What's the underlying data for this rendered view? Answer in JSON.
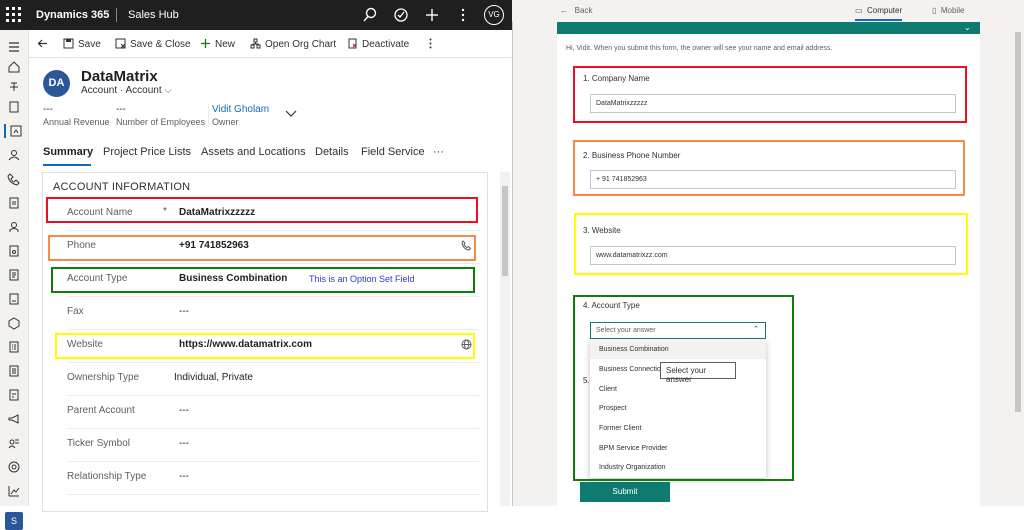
{
  "topbar": {
    "brand": "Dynamics 365",
    "app": "Sales Hub",
    "avatar": "VG"
  },
  "commands": {
    "save": "Save",
    "save_close": "Save & Close",
    "new": "New",
    "org_chart": "Open Org Chart",
    "deactivate": "Deactivate"
  },
  "record": {
    "initials": "DA",
    "name": "DataMatrix",
    "type_line": "Account · Account",
    "kpis": [
      {
        "value": "---",
        "label": "Annual Revenue"
      },
      {
        "value": "---",
        "label": "Number of Employees"
      }
    ],
    "owner": {
      "value": "Vidit Gholam",
      "label": "Owner"
    }
  },
  "tabs": [
    "Summary",
    "Project Price Lists",
    "Assets and Locations",
    "Details",
    "Field Service",
    "···"
  ],
  "section_title": "ACCOUNT INFORMATION",
  "fields": [
    {
      "label": "Account Name",
      "value": "DataMatrixzzzzz",
      "required": "*"
    },
    {
      "label": "Phone",
      "value": "+91 741852963"
    },
    {
      "label": "Account Type",
      "value": "Business Combination",
      "note": "This is an Option Set Field"
    },
    {
      "label": "Fax",
      "value": "---"
    },
    {
      "label": "Website",
      "value": "https://www.datamatrix.com"
    },
    {
      "label": "Ownership Type",
      "value": "Individual, Private"
    },
    {
      "label": "Parent Account",
      "value": "---"
    },
    {
      "label": "Ticker Symbol",
      "value": "---"
    },
    {
      "label": "Relationship Type",
      "value": "---"
    }
  ],
  "colors": {
    "red": "#e81123",
    "orange": "#f7894a",
    "green": "#107c10",
    "yellow": "#ffff00",
    "teal": "#0f7b70",
    "link": "#0f6cbd"
  },
  "preview": {
    "back": "Back",
    "computer": "Computer",
    "mobile": "Mobile",
    "intro": "Hi, Vidit. When you submit this form, the owner will see your name and email address.",
    "questions": [
      {
        "title": "1. Company Name",
        "value": "DataMatrixzzzzz"
      },
      {
        "title": "2. Business Phone Number",
        "value": "+ 91 741852963"
      },
      {
        "title": "3. Website",
        "value": "www.datamatrixzz.com"
      },
      {
        "title": "4. Account Type",
        "placeholder": "Select your answer"
      }
    ],
    "q5_prefix": "5.",
    "options": [
      "Business Combination",
      "Business Connection",
      "Client",
      "Prospect",
      "Former Client",
      "BPM Service Provider",
      "Industry Organization"
    ],
    "tooltip": "Select your answer",
    "submit": "Submit"
  }
}
